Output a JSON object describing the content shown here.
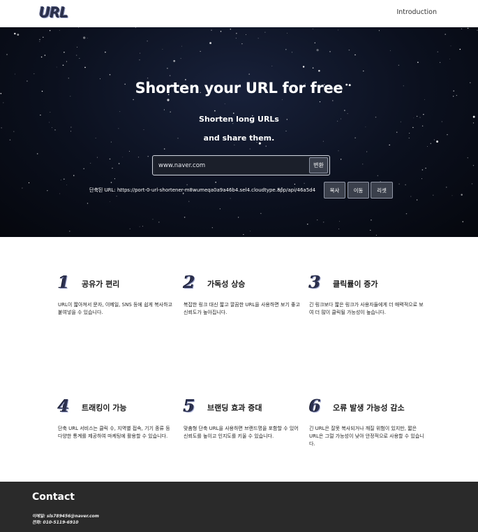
{
  "header": {
    "logo": "URL",
    "nav_intro": "Introduction"
  },
  "hero": {
    "title": "Shorten your URL for free",
    "subtitle_line1": "Shorten long URLs",
    "subtitle_line2": "and share them.",
    "input_value": "www.naver.com",
    "convert_label": "변환",
    "result_text": "단축된 URL: https://port-0-url-shortener-m8wumeqa0a9a46b4.sel4.cloudtype.app/api/46a5d4",
    "copy_label": "복사",
    "move_label": "이동",
    "reset_label": "리셋"
  },
  "features": [
    {
      "num": "1",
      "title": "공유가 편리",
      "desc": "URL이 짧아져서 문자, 이메일, SNS 등에 쉽게 복사하고 붙여넣을 수 있습니다."
    },
    {
      "num": "2",
      "title": "가독성 상승",
      "desc": "복잡한 링크 대신 짧고 깔끔한 URL을 사용하면 보기 좋고 신뢰도가 높아집니다."
    },
    {
      "num": "3",
      "title": "클릭률이 증가",
      "desc": "긴 링크보다 짧은 링크가 사용자들에게 더 매력적으로 보여 더 많이 클릭될 가능성이 높습니다."
    },
    {
      "num": "4",
      "title": "트래킹이 가능",
      "desc": "단축 URL 서비스는 클릭 수, 지역별 접속, 기기 종류 등 다양한 통계를 제공하여 마케팅에 활용할 수 있습니다."
    },
    {
      "num": "5",
      "title": "브랜딩 효과 증대",
      "desc": "맞춤형 단축 URL을 사용하면 브랜드명을 포함할 수 있어 신뢰도를 높이고 인지도를 키울 수 있습니다."
    },
    {
      "num": "6",
      "title": "오류 발생 가능성 감소",
      "desc": "긴 URL은 잘못 복사되거나 깨질 위험이 있지만, 짧은 URL은 그럴 가능성이 낮아 안정적으로 사용할 수 있습니다."
    }
  ],
  "footer": {
    "title": "Contact",
    "email": "이메일: sls789456@naver.com",
    "phone": "전화: 010-5119-6910"
  }
}
